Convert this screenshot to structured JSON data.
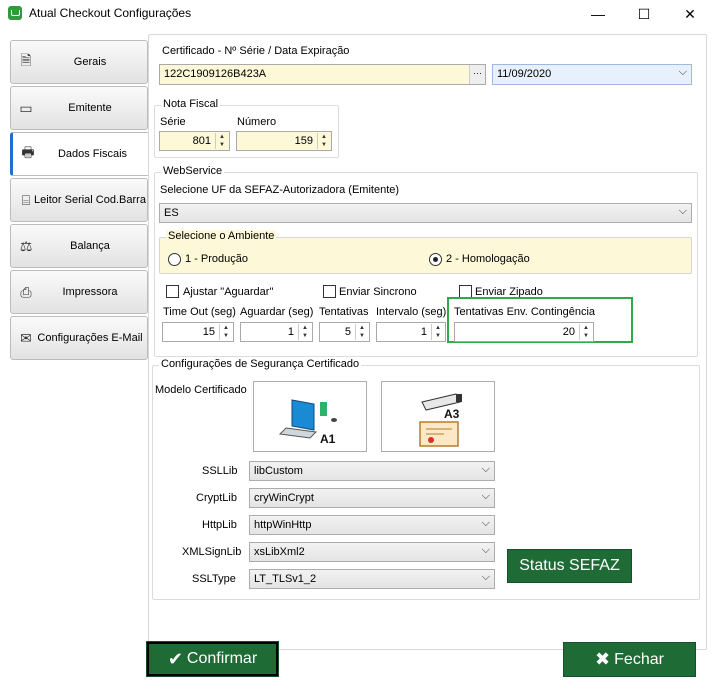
{
  "window": {
    "title": "Atual Checkout Configurações",
    "minimize": "—",
    "maximize": "☐",
    "close": "✕"
  },
  "tabs": [
    {
      "label": "Gerais",
      "icon": "document-icon",
      "glyph": "🗎"
    },
    {
      "label": "Emitente",
      "icon": "card-icon",
      "glyph": "▭"
    },
    {
      "label": "Dados Fiscais",
      "icon": "printer-receipt-icon",
      "glyph": "🖶"
    },
    {
      "label": "Leitor Serial Cod.Barra",
      "icon": "barcode-scanner-icon",
      "glyph": "⌸"
    },
    {
      "label": "Balança",
      "icon": "scale-icon",
      "glyph": "⚖"
    },
    {
      "label": "Impressora",
      "icon": "printer-icon",
      "glyph": "⎙"
    },
    {
      "label": "Configurações E-Mail",
      "icon": "email-icon",
      "glyph": "✉"
    }
  ],
  "certificado": {
    "title": "Certificado - Nº Série / Data Expiração",
    "serial": "122C1909126B423A",
    "browse": "···",
    "expiry": "11/09/2020"
  },
  "nota_fiscal": {
    "title": "Nota Fiscal",
    "serie_label": "Série",
    "serie_value": "801",
    "numero_label": "Número",
    "numero_value": "159"
  },
  "webservice": {
    "title": "WebService",
    "uf_label": "Selecione UF da SEFAZ-Autorizadora (Emitente)",
    "uf_value": "ES",
    "ambiente_title": "Selecione o Ambiente",
    "producao": "1 - Produção",
    "homologacao": "2 - Homologação",
    "ajustar": "Ajustar \"Aguardar\"",
    "enviar_sincrono": "Enviar Sincrono",
    "enviar_zipado": "Enviar Zipado",
    "timeout_label": "Time Out (seg)",
    "timeout_value": "15",
    "aguardar_label": "Aguardar (seg)",
    "aguardar_value": "1",
    "tentativas_label": "Tentativas",
    "tentativas_value": "5",
    "intervalo_label": "Intervalo (seg)",
    "intervalo_value": "1",
    "contingencia_label": "Tentativas Env. Contingência",
    "contingencia_value": "20"
  },
  "seguranca": {
    "title": "Configurações de Segurança Certificado",
    "modelo_label": "Modelo Certificado",
    "a1_label": "A1",
    "a3_label": "A3",
    "ssllib_label": "SSLLib",
    "ssllib_value": "libCustom",
    "cryptlib_label": "CryptLib",
    "cryptlib_value": "cryWinCrypt",
    "httplib_label": "HttpLib",
    "httplib_value": "httpWinHttp",
    "xmlsignlib_label": "XMLSignLib",
    "xmlsignlib_value": "xsLibXml2",
    "ssltype_label": "SSLType",
    "ssltype_value": "LT_TLSv1_2",
    "status_button": "Status SEFAZ"
  },
  "footer": {
    "confirmar": "Confirmar",
    "fechar": "Fechar"
  },
  "colors": {
    "accent_green": "#1e6b35",
    "highlight_border": "#2eaa4a",
    "input_yellow": "#fdf8d7",
    "ambiente_bg": "#fdf8d7"
  }
}
